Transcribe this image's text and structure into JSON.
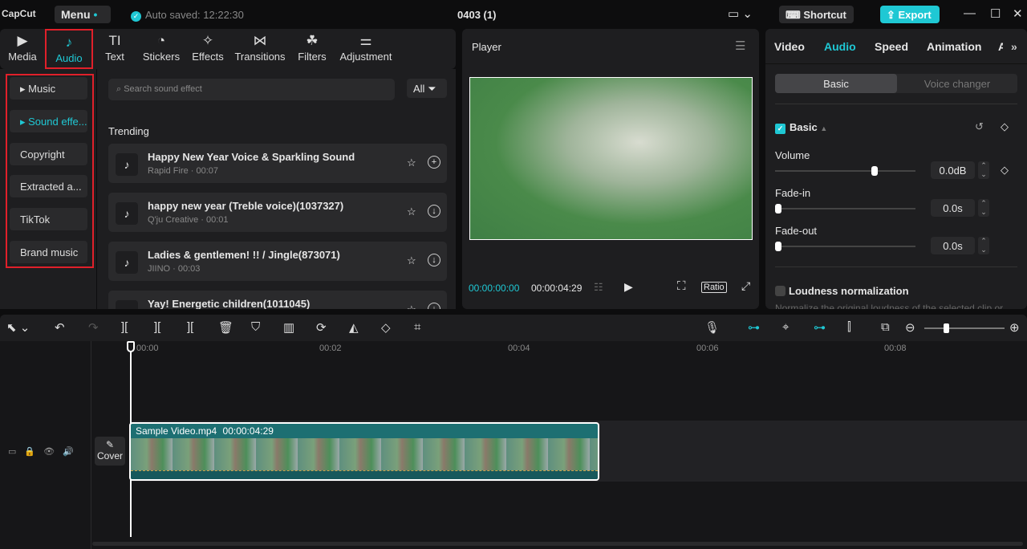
{
  "app": {
    "logo": "CapCut",
    "menu": "Menu",
    "auto_saved": "Auto saved: 12:22:30",
    "title": "0403 (1)",
    "shortcut": "Shortcut",
    "export": "Export"
  },
  "left_tabs": [
    {
      "label": "Media",
      "icon": "▶"
    },
    {
      "label": "Audio",
      "icon": "♪"
    },
    {
      "label": "Text",
      "icon": "TI"
    },
    {
      "label": "Stickers",
      "icon": "◔"
    },
    {
      "label": "Effects",
      "icon": "✧"
    },
    {
      "label": "Transitions",
      "icon": "⋈"
    },
    {
      "label": "Filters",
      "icon": "☘"
    },
    {
      "label": "Adjustment",
      "icon": "⚌"
    }
  ],
  "sidebar": [
    "Music",
    "Sound effe...",
    "Copyright",
    "Extracted a...",
    "TikTok",
    "Brand music"
  ],
  "search": {
    "placeholder": "Search sound effect",
    "filter": "All"
  },
  "trending": "Trending",
  "sounds": [
    {
      "name": "Happy New Year Voice & Sparkling Sound",
      "meta": "Rapid Fire · 00:07",
      "action": "+"
    },
    {
      "name": "happy new year (Treble voice)(1037327)",
      "meta": "Q'ju Creative · 00:01",
      "action": "↓"
    },
    {
      "name": "Ladies & gentlemen! !! / Jingle(873071)",
      "meta": "JIINO · 00:03",
      "action": "↓"
    },
    {
      "name": "Yay! Energetic children(1011045)",
      "meta": "",
      "action": "↓"
    }
  ],
  "player": {
    "title": "Player",
    "current": "00:00:00:00",
    "total": "00:00:04:29",
    "ratio": "Ratio"
  },
  "right": {
    "tabs": [
      "Video",
      "Audio",
      "Speed",
      "Animation",
      "A"
    ],
    "seg": [
      "Basic",
      "Voice changer"
    ],
    "section": "Basic",
    "volume": {
      "label": "Volume",
      "value": "0.0dB",
      "fraction": 0.72
    },
    "fade_in": {
      "label": "Fade-in",
      "value": "0.0s"
    },
    "fade_out": {
      "label": "Fade-out",
      "value": "0.0s"
    },
    "loudness": "Loudness normalization",
    "loudness_desc": "Normalize the original loudness of the selected clip or"
  },
  "timeline": {
    "ticks": [
      "00:00",
      "00:02",
      "00:04",
      "00:06",
      "00:08"
    ],
    "cover": "Cover",
    "clip_name": "Sample Video.mp4",
    "clip_duration": "00:00:04:29"
  },
  "colors": {
    "accent": "#1fc8d4",
    "highlight": "#e0202a"
  }
}
